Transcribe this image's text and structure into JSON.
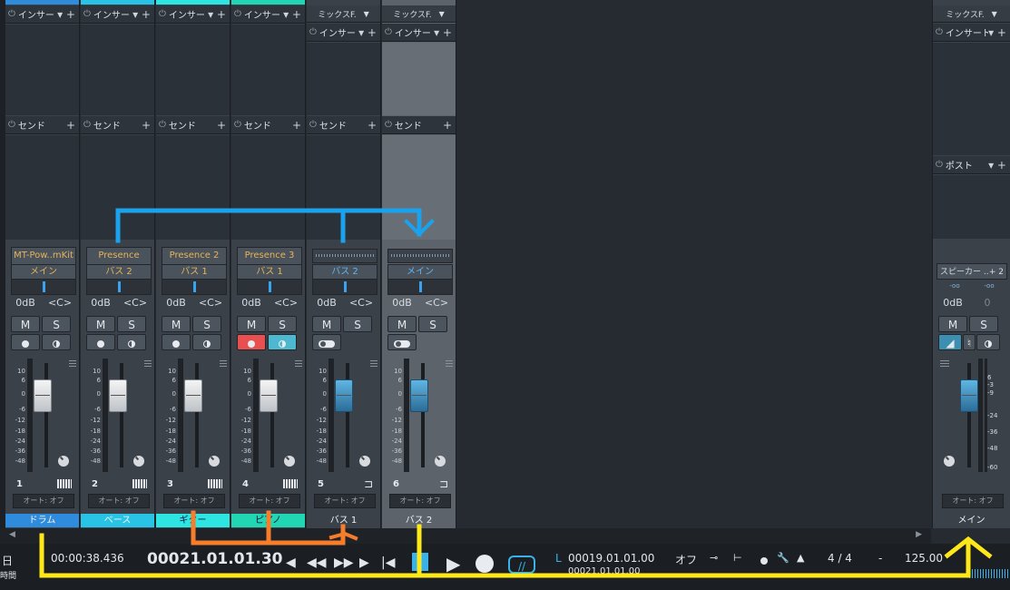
{
  "channels": [
    {
      "num": "1",
      "name": "ドラム",
      "color": "#2f8bdc",
      "insert": "インサート",
      "send": "センド",
      "instrument": "MT-Pow..mKit",
      "output": "メイン",
      "vol": "0dB",
      "pan": "<C>",
      "mute": "M",
      "solo": "S",
      "auto": "オート: オフ",
      "type": "inst"
    },
    {
      "num": "2",
      "name": "ベース",
      "color": "#29c3e6",
      "insert": "インサート",
      "send": "センド",
      "instrument": "Presence",
      "output": "バス 2",
      "vol": "0dB",
      "pan": "<C>",
      "mute": "M",
      "solo": "S",
      "auto": "オート: オフ",
      "type": "inst"
    },
    {
      "num": "3",
      "name": "ギター",
      "color": "#2ee6e1",
      "insert": "インサート",
      "send": "センド",
      "instrument": "Presence 2",
      "output": "バス 1",
      "vol": "0dB",
      "pan": "<C>",
      "mute": "M",
      "solo": "S",
      "auto": "オート: オフ",
      "type": "inst"
    },
    {
      "num": "4",
      "name": "ピアノ",
      "color": "#21d6b2",
      "insert": "インサート",
      "send": "センド",
      "instrument": "Presence 3",
      "output": "バス 1",
      "vol": "0dB",
      "pan": "<C>",
      "mute": "M",
      "solo": "S",
      "auto": "オート: オフ",
      "type": "inst"
    },
    {
      "num": "5",
      "name": "バス 1",
      "color": "#3a4149",
      "mix": "ミックスF.",
      "insert": "インサート",
      "send": "センド",
      "output": "バス 2",
      "vol": "0dB",
      "pan": "<C>",
      "mute": "M",
      "solo": "S",
      "auto": "オート: オフ",
      "type": "bus"
    },
    {
      "num": "6",
      "name": "バス 2",
      "color": "#5c636b",
      "mix": "ミックスF.",
      "insert": "インサート",
      "send": "センド",
      "output": "メイン",
      "vol": "0dB",
      "pan": "<C>",
      "mute": "M",
      "solo": "S",
      "auto": "オート: オフ",
      "type": "bus"
    }
  ],
  "master": {
    "mix": "ミックスF.",
    "insert": "インサート",
    "post": "ポスト",
    "device": "スピーカー ..",
    "device_count": "+ 2",
    "left_val": "-oo",
    "right_val": "-oo",
    "vol": "0dB",
    "pan": "0",
    "mute": "M",
    "solo": "S",
    "auto": "オート: オフ",
    "name": "メイン",
    "scale": [
      "6",
      "-3",
      "-9",
      "-24",
      "-36",
      "-48",
      "-60"
    ]
  },
  "scale": [
    "10",
    "6",
    "0",
    "-6",
    "-12",
    "-18",
    "-24",
    "-36",
    "-48"
  ],
  "transport": {
    "left_label_top": "日",
    "left_label_bottom": "時間",
    "seconds": "00:00:38.436",
    "bars": "00021.01.01.30",
    "loop_l_label": "L",
    "loop_l": "00019.01.01.00",
    "loop_r_cut": "00021.01.01.00",
    "sync": "オフ",
    "time_sig": "4 / 4",
    "dash": "-",
    "tempo": "125.00"
  },
  "annotation_colors": {
    "blue": "#1aa3ec",
    "orange": "#f77d2b",
    "yellow": "#ffe81a"
  }
}
